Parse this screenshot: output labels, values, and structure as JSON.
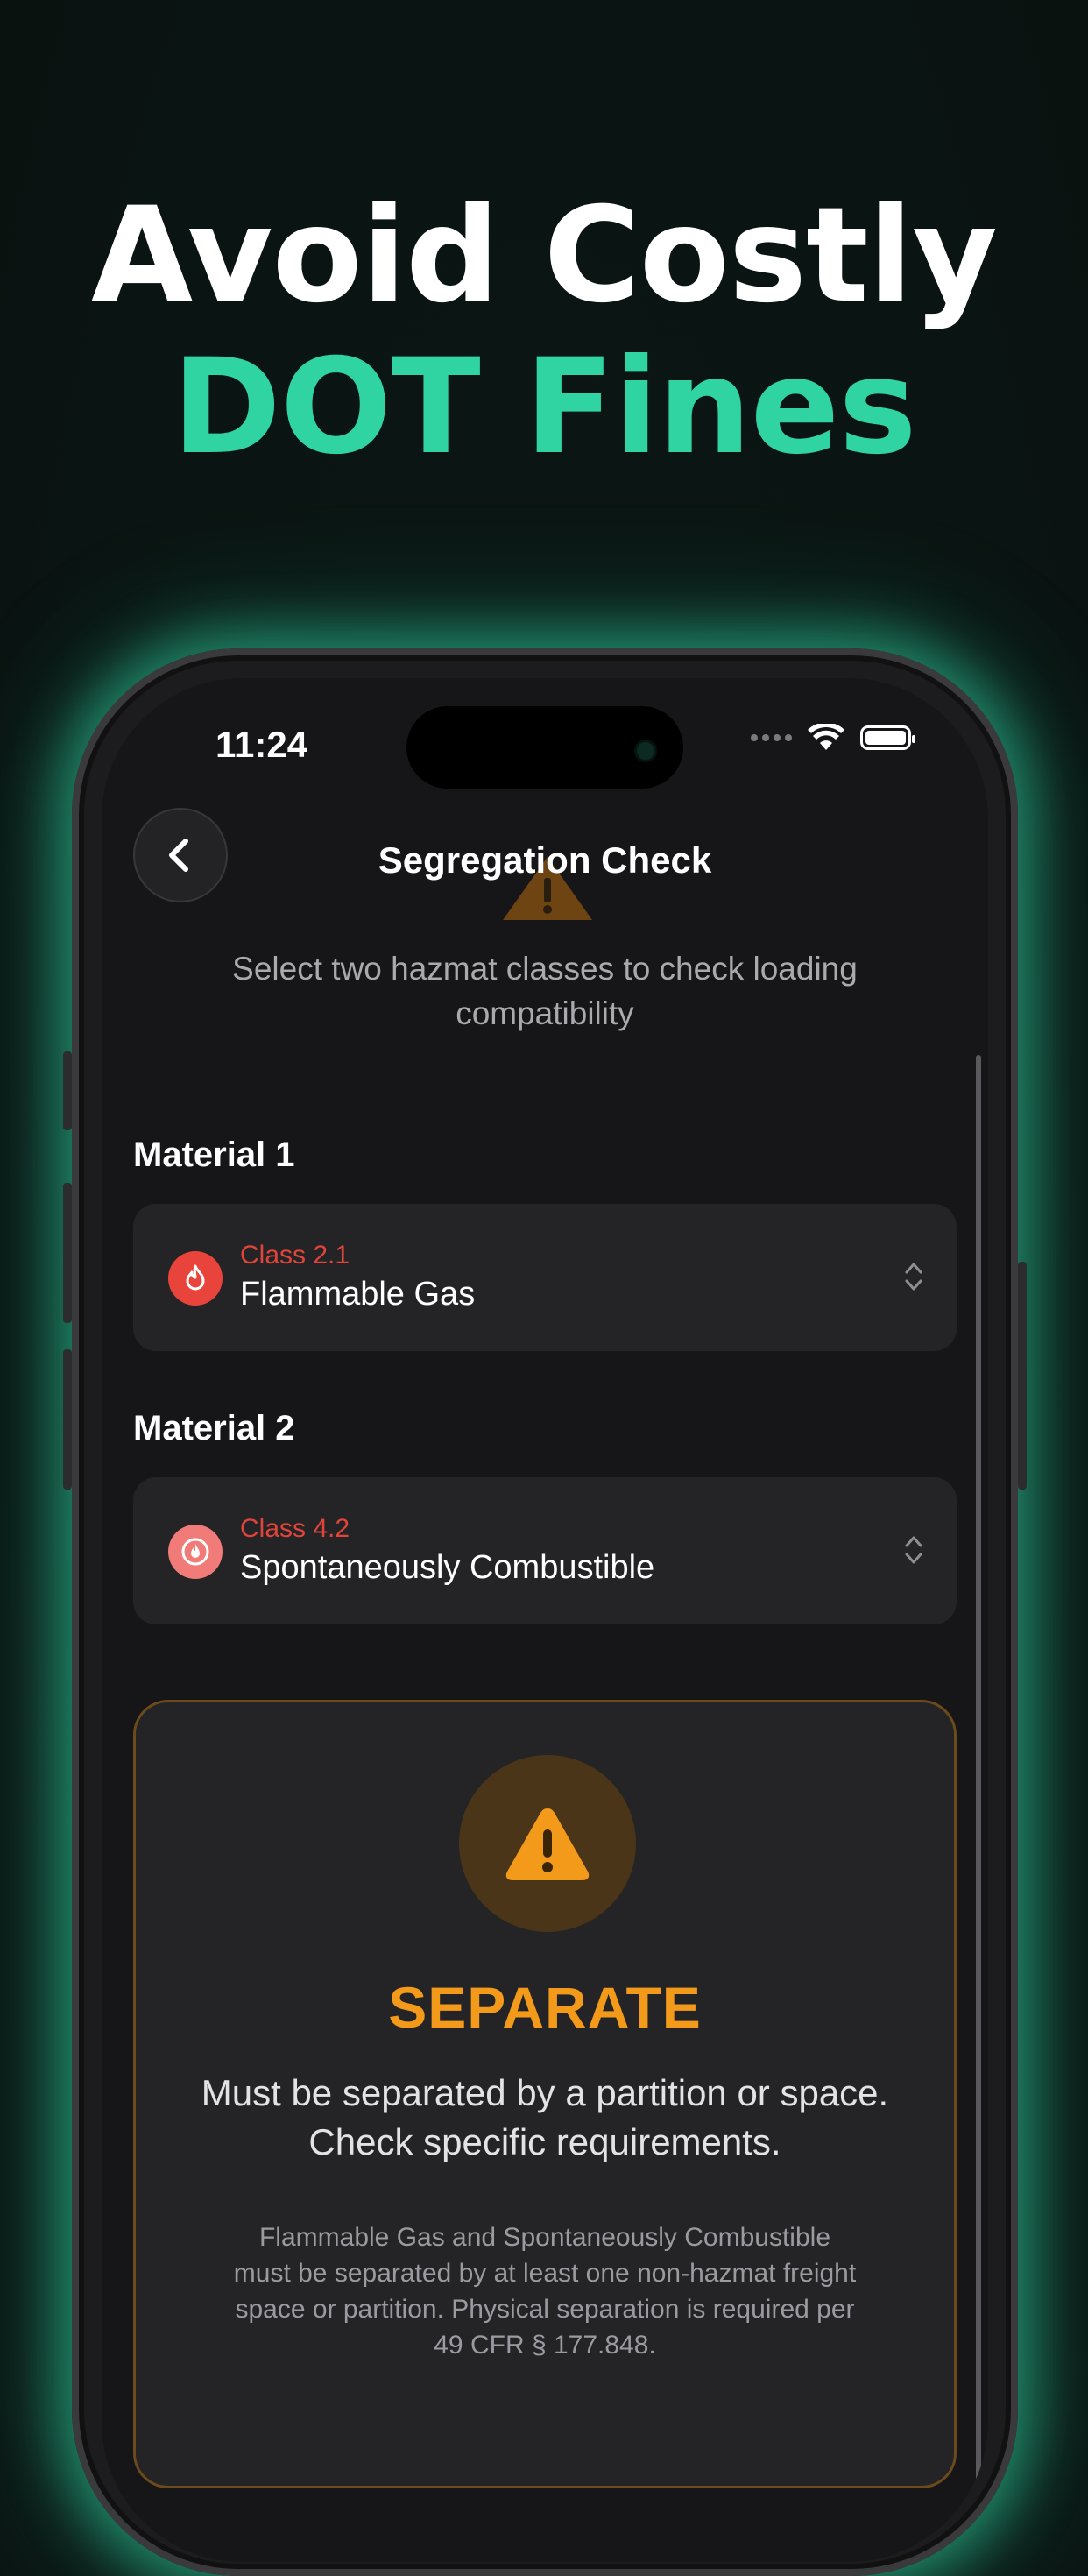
{
  "headline": {
    "line1": "Avoid Costly",
    "line2": "DOT Fines"
  },
  "status_bar": {
    "time": "11:24"
  },
  "nav": {
    "title": "Segregation Check",
    "back_icon": "chevron-left-icon"
  },
  "subtitle": "Select two hazmat classes to check loading compatibility",
  "material1": {
    "label": "Material 1",
    "class": "Class 2.1",
    "name": "Flammable Gas",
    "icon": "flame-icon",
    "badge_color": "#e8443b"
  },
  "material2": {
    "label": "Material 2",
    "class": "Class 4.2",
    "name": "Spontaneously Combustible",
    "icon": "flame-circle-icon",
    "badge_color": "#f07b78"
  },
  "result": {
    "title": "SEPARATE",
    "message": "Must be separated by a partition or space. Check specific requirements.",
    "detail": "Flammable Gas and Spontaneously Combustible must be separated by at least one non-hazmat freight space or partition. Physical separation is required per 49 CFR § 177.848.",
    "icon": "warning-triangle-icon",
    "color": "#f39a1a"
  },
  "colors": {
    "accent": "#2fd4a2",
    "background": "#0b1513",
    "class_label": "#e0443b"
  }
}
